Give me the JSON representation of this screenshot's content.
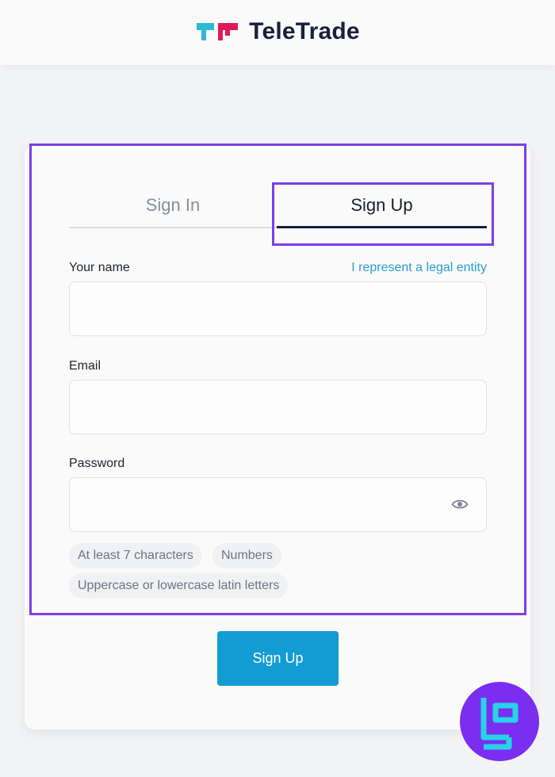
{
  "brand": {
    "name": "TeleTrade",
    "logo_colors": {
      "teal": "#2db8d6",
      "magenta": "#e01a5a"
    }
  },
  "tabs": {
    "signin_label": "Sign In",
    "signup_label": "Sign Up",
    "active": "Sign Up"
  },
  "form": {
    "name_label": "Your name",
    "legal_entity_link": "I represent a legal entity",
    "name_value": "",
    "email_label": "Email",
    "email_value": "",
    "password_label": "Password",
    "password_value": "",
    "password_visibility_icon": "eye-icon"
  },
  "password_hints": [
    "At least 7 characters",
    "Numbers",
    "Uppercase or lowercase latin letters"
  ],
  "submit_label": "Sign Up",
  "colors": {
    "accent": "#139bd3",
    "highlight": "#7b3fe4",
    "link": "#2a9ccf",
    "watermark": "#7a2ef0"
  }
}
